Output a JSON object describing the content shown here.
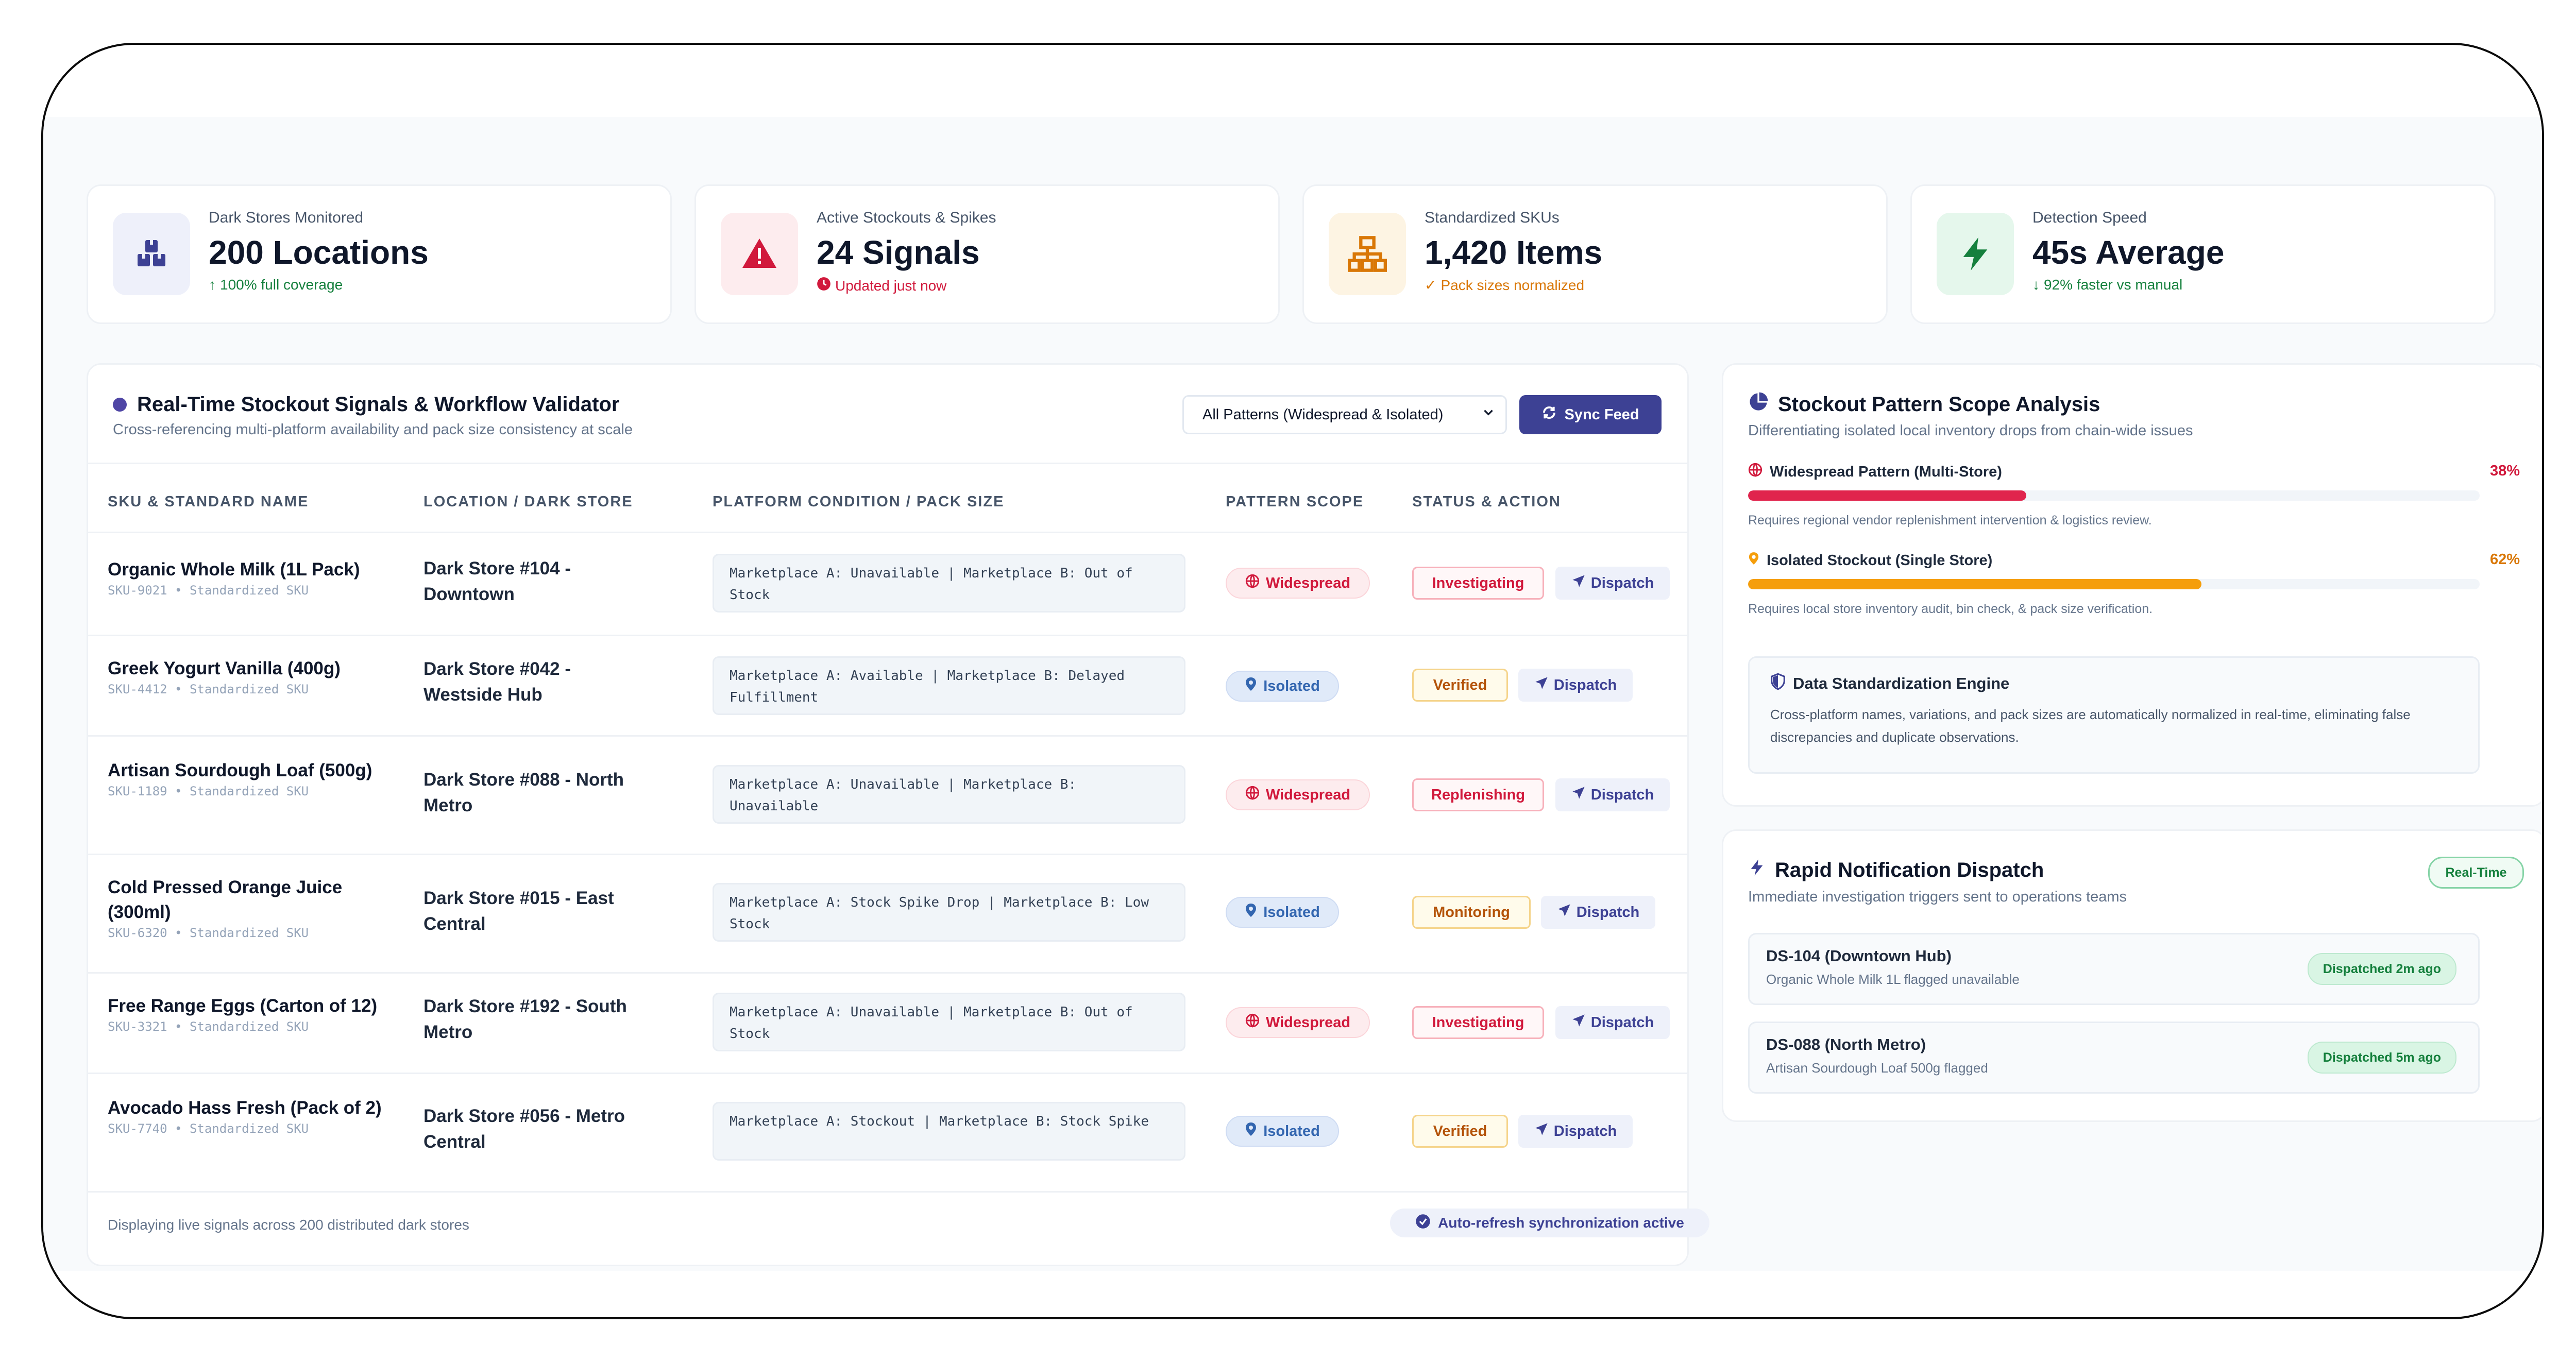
{
  "kpis": [
    {
      "label": "Dark Stores Monitored",
      "value": "200 Locations",
      "foot": "100% full coverage",
      "foot_icon": "arrow-up-icon",
      "icon": "boxes-icon",
      "color": "#15803d",
      "icon_color": "#3d4194",
      "icon_bg": "#eef0fa"
    },
    {
      "label": "Active Stockouts & Spikes",
      "value": "24 Signals",
      "foot": "Updated just now",
      "foot_icon": "clock-icon",
      "icon": "warning-triangle-icon",
      "color": "#d1193c",
      "icon_color": "#d1193c",
      "icon_bg": "#fdecee"
    },
    {
      "label": "Standardized SKUs",
      "value": "1,420 Items",
      "foot": "Pack sizes normalized",
      "foot_icon": "check-icon",
      "icon": "hierarchy-icon",
      "color": "#d97706",
      "icon_color": "#d97706",
      "icon_bg": "#fdf4e3"
    },
    {
      "label": "Detection Speed",
      "value": "45s Average",
      "foot": "92% faster vs manual",
      "foot_icon": "arrow-down-icon",
      "icon": "bolt-icon",
      "color": "#15803d",
      "icon_color": "#15803d",
      "icon_bg": "#e5f7ec"
    }
  ],
  "signals": {
    "title": "Real-Time Stockout Signals & Workflow Validator",
    "subtitle": "Cross-referencing multi-platform availability and pack size consistency at scale",
    "filter_value": "All Patterns (Widespread & Isolated)",
    "sync_label": "Sync Feed",
    "columns": [
      "SKU & STANDARD NAME",
      "LOCATION / DARK STORE",
      "PLATFORM CONDITION / PACK SIZE",
      "PATTERN SCOPE",
      "STATUS & ACTION"
    ],
    "rows": [
      {
        "name": "Organic Whole Milk (1L Pack)",
        "sku": "SKU-9021 • Standardized SKU",
        "location": "Dark Store #104 - Downtown",
        "condition": "Marketplace A: Unavailable | Marketplace B: Out of Stock",
        "scope": "Widespread",
        "status": "Investigating",
        "action": "Dispatch"
      },
      {
        "name": "Greek Yogurt Vanilla (400g)",
        "sku": "SKU-4412 • Standardized SKU",
        "location": "Dark Store #042 - Westside Hub",
        "condition": "Marketplace A: Available | Marketplace B: Delayed Fulfillment",
        "scope": "Isolated",
        "status": "Verified",
        "action": "Dispatch"
      },
      {
        "name": "Artisan Sourdough Loaf (500g)",
        "sku": "SKU-1189 • Standardized SKU",
        "location": "Dark Store #088 - North Metro",
        "condition": "Marketplace A: Unavailable | Marketplace B: Unavailable",
        "scope": "Widespread",
        "status": "Replenishing",
        "action": "Dispatch"
      },
      {
        "name": "Cold Pressed Orange Juice (300ml)",
        "sku": "SKU-6320 • Standardized SKU",
        "location": "Dark Store #015 - East Central",
        "condition": "Marketplace A: Stock Spike Drop | Marketplace B: Low Stock",
        "scope": "Isolated",
        "status": "Monitoring",
        "action": "Dispatch"
      },
      {
        "name": "Free Range Eggs (Carton of 12)",
        "sku": "SKU-3321 • Standardized SKU",
        "location": "Dark Store #192 - South Metro",
        "condition": "Marketplace A: Unavailable | Marketplace B: Out of Stock",
        "scope": "Widespread",
        "status": "Investigating",
        "action": "Dispatch"
      },
      {
        "name": "Avocado Hass Fresh (Pack of 2)",
        "sku": "SKU-7740 • Standardized SKU",
        "location": "Dark Store #056 - Metro Central",
        "condition": "Marketplace A: Stockout | Marketplace B: Stock Spike",
        "scope": "Isolated",
        "status": "Verified",
        "action": "Dispatch"
      }
    ],
    "footer_text": "Displaying live signals across 200 distributed dark stores",
    "auto_refresh": "Auto-refresh synchronization active"
  },
  "scope": {
    "title": "Stockout Pattern Scope Analysis",
    "subtitle": "Differentiating isolated local inventory drops from chain-wide issues",
    "widespread": {
      "label": "Widespread Pattern (Multi-Store)",
      "pct": "38%",
      "value": 0.38,
      "desc": "Requires regional vendor replenishment intervention & logistics review.",
      "color": "#e0244d"
    },
    "isolated": {
      "label": "Isolated Stockout (Single Store)",
      "pct": "62%",
      "value": 0.62,
      "desc": "Requires local store inventory audit, bin check, & pack size verification.",
      "color": "#f59e0b"
    },
    "engine_title": "Data Standardization Engine",
    "engine_text": "Cross-platform names, variations, and pack sizes are automatically normalized in real-time, eliminating false discrepancies and duplicate observations."
  },
  "notify": {
    "title": "Rapid Notification Dispatch",
    "subtitle": "Immediate investigation triggers sent to operations teams",
    "badge": "Real-Time",
    "items": [
      {
        "title": "DS-104 (Downtown Hub)",
        "sub": "Organic Whole Milk 1L flagged unavailable",
        "badge": "Dispatched 2m ago"
      },
      {
        "title": "DS-088 (North Metro)",
        "sub": "Artisan Sourdough Loaf 500g flagged",
        "badge": "Dispatched 5m ago"
      }
    ]
  }
}
